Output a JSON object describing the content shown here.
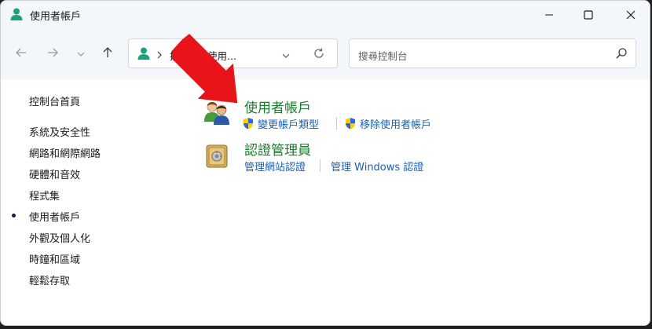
{
  "window": {
    "title": "使用者帳戶",
    "icon": "user-accounts-icon"
  },
  "titlebar_buttons": {
    "minimize": "minimize-icon",
    "maximize": "maximize-icon",
    "close": "close-icon"
  },
  "navigation": {
    "back": "back-arrow-icon",
    "forward": "forward-arrow-icon",
    "recent": "chevron-down-icon",
    "up": "up-arrow-icon"
  },
  "address": {
    "crumbs": [
      "控...",
      "使用..."
    ],
    "refresh": "refresh-icon"
  },
  "search": {
    "placeholder": "搜尋控制台"
  },
  "sidebar": {
    "home": "控制台首頁",
    "items": [
      {
        "label": "系統及安全性",
        "active": false
      },
      {
        "label": "網路和網際網路",
        "active": false
      },
      {
        "label": "硬體和音效",
        "active": false
      },
      {
        "label": "程式集",
        "active": false
      },
      {
        "label": "使用者帳戶",
        "active": true
      },
      {
        "label": "外觀及個人化",
        "active": false
      },
      {
        "label": "時鐘和區域",
        "active": false
      },
      {
        "label": "輕鬆存取",
        "active": false
      }
    ]
  },
  "categories": [
    {
      "title": "使用者帳戶",
      "icon": "users-icon",
      "links": [
        {
          "label": "變更帳戶類型",
          "icon": "uac-shield-icon"
        },
        {
          "label": "移除使用者帳戶",
          "icon": "uac-shield-icon"
        }
      ]
    },
    {
      "title": "認證管理員",
      "icon": "credential-vault-icon",
      "links": [
        {
          "label": "管理網站認證"
        },
        {
          "label": "管理 Windows 認證"
        }
      ]
    }
  ],
  "colors": {
    "category_title": "#1e7a2e",
    "link": "#1a5fb4",
    "annotation_arrow": "#e8141a",
    "titlebar_bg": "#f3f6fb"
  }
}
